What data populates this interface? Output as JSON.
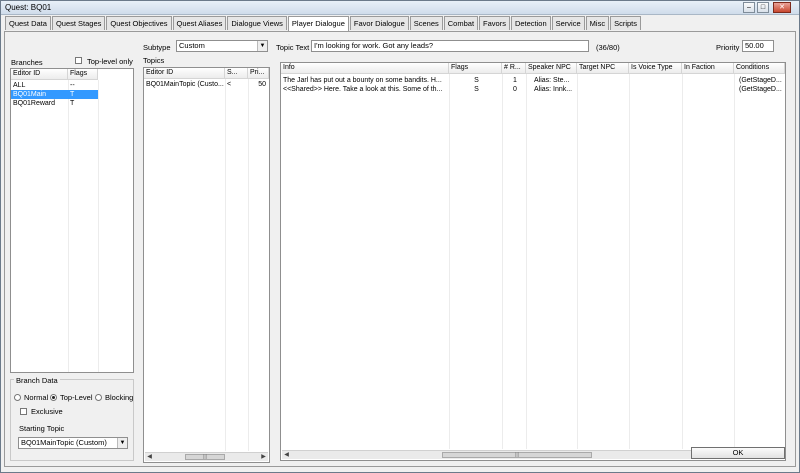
{
  "window": {
    "title": "Quest: BQ01"
  },
  "tabs": [
    {
      "label": "Quest Data"
    },
    {
      "label": "Quest Stages"
    },
    {
      "label": "Quest Objectives"
    },
    {
      "label": "Quest Aliases"
    },
    {
      "label": "Dialogue Views"
    },
    {
      "label": "Player Dialogue",
      "active": true
    },
    {
      "label": "Favor Dialogue"
    },
    {
      "label": "Scenes"
    },
    {
      "label": "Combat"
    },
    {
      "label": "Favors"
    },
    {
      "label": "Detection"
    },
    {
      "label": "Service"
    },
    {
      "label": "Misc"
    },
    {
      "label": "Scripts"
    }
  ],
  "branches": {
    "label": "Branches",
    "top_level_only_label": "Top-level only",
    "columns": [
      "Editor ID",
      "Flags"
    ],
    "rows": [
      {
        "id": "ALL",
        "flags": "--"
      },
      {
        "id": "BQ01Main",
        "flags": "T",
        "selected": true
      },
      {
        "id": "BQ01Reward",
        "flags": "T"
      }
    ]
  },
  "subtype": {
    "label": "Subtype",
    "value": "Custom"
  },
  "topics": {
    "label": "Topics",
    "columns": [
      "Editor ID",
      "S...",
      "Pri..."
    ],
    "rows": [
      {
        "id": "BQ01MainTopic (Custo...",
        "s": "<",
        "pri": "50"
      }
    ]
  },
  "topic_text": {
    "label": "Topic Text",
    "value": "I'm looking for work.  Got any leads?",
    "count": "(36/80)"
  },
  "priority": {
    "label": "Priority",
    "value": "50.00"
  },
  "info_table": {
    "columns": [
      "Info",
      "Flags",
      "# R...",
      "Speaker NPC",
      "Target NPC",
      "Is Voice Type",
      "In Faction",
      "Conditions"
    ],
    "rows": [
      {
        "info": "The Jarl has put out a bounty on some bandits.  H...",
        "flags": "S",
        "r": "1",
        "speaker": "Alias: Ste...",
        "target": "",
        "voice": "",
        "faction": "",
        "conditions": "(GetStageD..."
      },
      {
        "info": "<<Shared>> Here.  Take a look at this.  Some of th...",
        "flags": "S",
        "r": "0",
        "speaker": "Alias: Innk...",
        "target": "",
        "voice": "",
        "faction": "",
        "conditions": "(GetStageD..."
      }
    ]
  },
  "branch_data": {
    "label": "Branch Data",
    "types": [
      {
        "label": "Normal",
        "checked": false
      },
      {
        "label": "Top-Level",
        "checked": true
      },
      {
        "label": "Blocking",
        "checked": false
      }
    ],
    "exclusive_label": "Exclusive",
    "starting_topic_label": "Starting Topic",
    "starting_topic_value": "BQ01MainTopic (Custom)"
  },
  "ok_label": "OK"
}
